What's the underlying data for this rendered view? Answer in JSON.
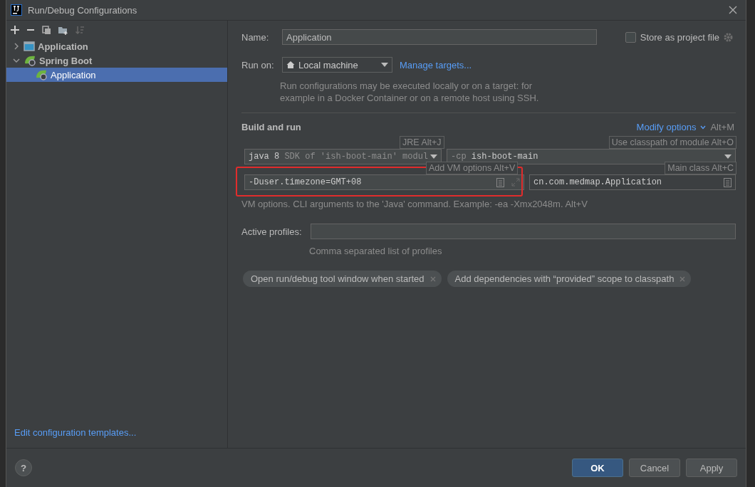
{
  "window": {
    "title": "Run/Debug Configurations"
  },
  "tree": [
    {
      "label": "Application",
      "kind": "application",
      "expanded": false,
      "selected": false
    },
    {
      "label": "Spring Boot",
      "kind": "spring",
      "expanded": true,
      "selected": false,
      "children": [
        {
          "label": "Application",
          "kind": "spring",
          "selected": true
        }
      ]
    }
  ],
  "sidebar_link": "Edit configuration templates...",
  "name": {
    "label": "Name:",
    "value": "Application"
  },
  "store": {
    "label": "Store as project file",
    "checked": false
  },
  "run_on": {
    "label": "Run on:",
    "value": "Local machine",
    "link": "Manage targets...",
    "description": "Run configurations may be executed locally or on a target: for example in a Docker Container or on a remote host using SSH."
  },
  "build_and_run": {
    "title": "Build and run",
    "modify": "Modify options",
    "modify_shortcut": "Alt+M",
    "jre": {
      "version": "java 8",
      "detail": "SDK of 'ish-boot-main' modul"
    },
    "classpath": {
      "prefix": "-cp",
      "value": "ish-boot-main"
    },
    "vm_options": {
      "value": "-Duser.timezone=GMT+08"
    },
    "main_class": {
      "value": "cn.com.medmap.Application"
    },
    "hint": "VM options. CLI arguments to the 'Java' command. Example: -ea -Xmx2048m. Alt+V",
    "tooltips": [
      {
        "kind": "jre",
        "text": "JRE Alt+J"
      },
      {
        "kind": "classpath",
        "text": "Use classpath of module Alt+O"
      },
      {
        "kind": "vm",
        "text": "Add VM options Alt+V"
      },
      {
        "kind": "main",
        "text": "Main class Alt+C"
      }
    ]
  },
  "active_profiles": {
    "label": "Active profiles:",
    "hint": "Comma separated list of profiles"
  },
  "chips": [
    "Open run/debug tool window when started",
    "Add dependencies with “provided” scope to classpath"
  ],
  "help_button": "?",
  "buttons": [
    {
      "label": "OK",
      "kind": "primary"
    },
    {
      "label": "Cancel",
      "kind": "normal"
    },
    {
      "label": "Apply",
      "kind": "normal"
    }
  ]
}
